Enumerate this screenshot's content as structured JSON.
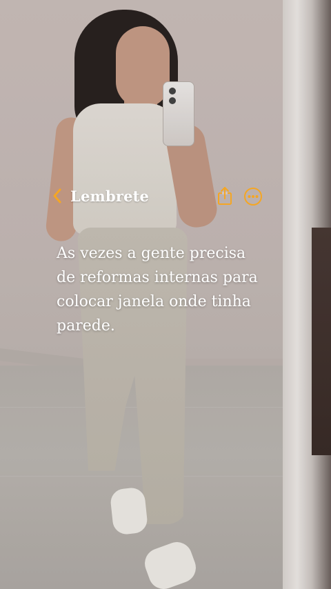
{
  "header": {
    "back_label": "Lembrete",
    "accent_color": "#F5A623"
  },
  "icons": {
    "back": "chevron-left-icon",
    "share": "share-icon",
    "more": "more-horizontal-icon"
  },
  "note": {
    "lines": [
      "As vezes a gente precisa",
      "de reformas internas para",
      "colocar janela onde tinha",
      "parede."
    ]
  }
}
